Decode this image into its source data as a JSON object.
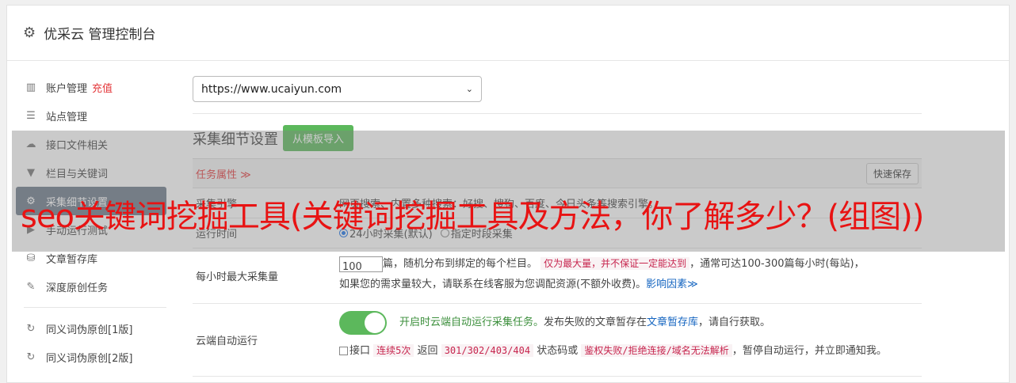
{
  "header": {
    "title": "优采云 管理控制台"
  },
  "sidebar": {
    "items": [
      {
        "icon": "bar-chart-icon",
        "label": "账户管理",
        "extra": "充值"
      },
      {
        "icon": "server-icon",
        "label": "站点管理"
      },
      {
        "icon": "cloud-upload-icon",
        "label": "接口文件相关"
      },
      {
        "icon": "filter-icon",
        "label": "栏目与关键词"
      },
      {
        "icon": "gears-icon",
        "label": "采集细节设置"
      },
      {
        "icon": "play-icon",
        "label": "手动运行测试"
      },
      {
        "icon": "database-icon",
        "label": "文章暂存库"
      },
      {
        "icon": "edit-icon",
        "label": "深度原创任务"
      },
      {
        "icon": "refresh-icon",
        "label": "同义词伪原创[1版]"
      },
      {
        "icon": "refresh-icon",
        "label": "同义词伪原创[2版]"
      }
    ]
  },
  "main": {
    "site_select": "https://www.ucaiyun.com",
    "section_title": "采集细节设置",
    "import_button": "从模板导入",
    "task_attr": "任务属性 ≫",
    "quick_save": "快速保存",
    "row_engine_label": "采集引擎",
    "row_engine_text": "网页搜索、内置多种搜索：好搜、搜狗、百度、今日头条等搜索引擎。",
    "run_time_label": "运行时间",
    "run_time_opt1": "24小时采集(默认)",
    "run_time_opt2": "指定时段采集",
    "max_label": "每小时最大采集量",
    "max_value": "100",
    "max_text1": "篇，随机分布到绑定的每个栏目。",
    "max_code": "仅为最大量，并不保证一定能达到",
    "max_text2": "，通常可达100-300篇每小时(每站)，",
    "max_text3": "如果您的需求量较大，请联系在线客服为您调配资源(不额外收费)。",
    "max_link": "影响因素≫",
    "auto_label": "云端自动运行",
    "auto_text1": "开启时云端自动运行采集任务。",
    "auto_text2": "发布失败的文章暂存在",
    "auto_link": "文章暂存库",
    "auto_text3": "，请自行获取。",
    "api_text1": "接口",
    "api_code1": "连续5次",
    "api_text2": "返回",
    "api_code2": "301/302/403/404",
    "api_text3": "状态码或",
    "api_code3": "鉴权失败/拒绝连接/域名无法解析",
    "api_text4": "，暂停自动运行，并立即通知我。"
  },
  "overlay": {
    "text": "seo关键词挖掘工具(关键词挖掘工具及方法，你了解多少？(组图))"
  }
}
